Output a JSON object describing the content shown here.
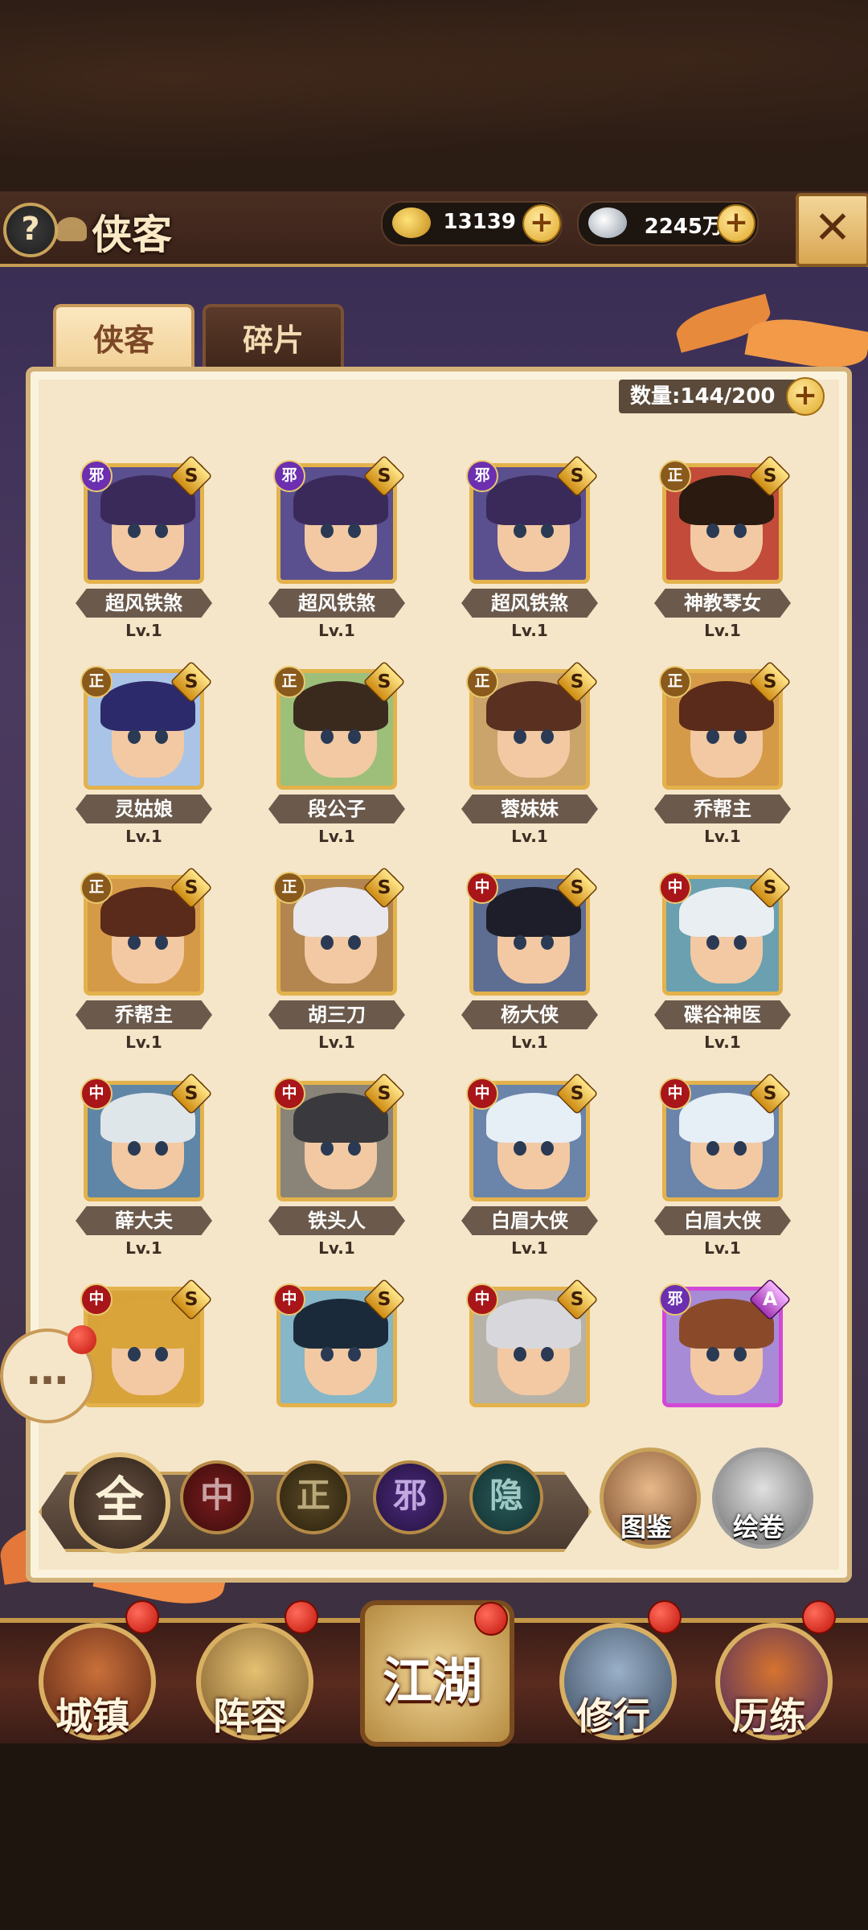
{
  "header": {
    "help": "?",
    "title": "侠客",
    "gold": "13139",
    "silver": "2245万",
    "plus": "+",
    "close": "✕"
  },
  "tabs": [
    {
      "label": "侠客",
      "active": true
    },
    {
      "label": "碎片",
      "active": false
    }
  ],
  "count": "数量:144/200",
  "heroes": [
    {
      "name": "超风铁煞",
      "level": "Lv.1",
      "faction": "邪",
      "grade": "S"
    },
    {
      "name": "超风铁煞",
      "level": "Lv.1",
      "faction": "邪",
      "grade": "S"
    },
    {
      "name": "超风铁煞",
      "level": "Lv.1",
      "faction": "邪",
      "grade": "S"
    },
    {
      "name": "神教琴女",
      "level": "Lv.1",
      "faction": "正",
      "grade": "S"
    },
    {
      "name": "灵姑娘",
      "level": "Lv.1",
      "faction": "正",
      "grade": "S"
    },
    {
      "name": "段公子",
      "level": "Lv.1",
      "faction": "正",
      "grade": "S"
    },
    {
      "name": "蓉妹妹",
      "level": "Lv.1",
      "faction": "正",
      "grade": "S"
    },
    {
      "name": "乔帮主",
      "level": "Lv.1",
      "faction": "正",
      "grade": "S"
    },
    {
      "name": "乔帮主",
      "level": "Lv.1",
      "faction": "正",
      "grade": "S"
    },
    {
      "name": "胡三刀",
      "level": "Lv.1",
      "faction": "正",
      "grade": "S"
    },
    {
      "name": "杨大侠",
      "level": "Lv.1",
      "faction": "中",
      "grade": "S"
    },
    {
      "name": "碟谷神医",
      "level": "Lv.1",
      "faction": "中",
      "grade": "S"
    },
    {
      "name": "薛大夫",
      "level": "Lv.1",
      "faction": "中",
      "grade": "S"
    },
    {
      "name": "铁头人",
      "level": "Lv.1",
      "faction": "中",
      "grade": "S"
    },
    {
      "name": "白眉大侠",
      "level": "Lv.1",
      "faction": "中",
      "grade": "S"
    },
    {
      "name": "白眉大侠",
      "level": "Lv.1",
      "faction": "中",
      "grade": "S"
    },
    {
      "faction": "中",
      "grade": "S"
    },
    {
      "faction": "中",
      "grade": "S"
    },
    {
      "faction": "中",
      "grade": "S"
    },
    {
      "faction": "邪",
      "grade": "A"
    }
  ],
  "filters": [
    "全",
    "中",
    "正",
    "邪",
    "隐"
  ],
  "side_buttons": {
    "atlas": "图鉴",
    "scroll": "绘卷"
  },
  "chat_icon": "…",
  "nav": {
    "town": "城镇",
    "lineup": "阵容",
    "jianghu": "江湖",
    "train": "修行",
    "trial": "历练"
  },
  "colors": {
    "faction_邪": "#6b2fb0",
    "faction_正": "#8a5a1c",
    "faction_中": "#a8161a",
    "faction_隐": "#2d6a6a",
    "grade_S": "#e6b13a",
    "grade_A": "#c24fd3"
  }
}
